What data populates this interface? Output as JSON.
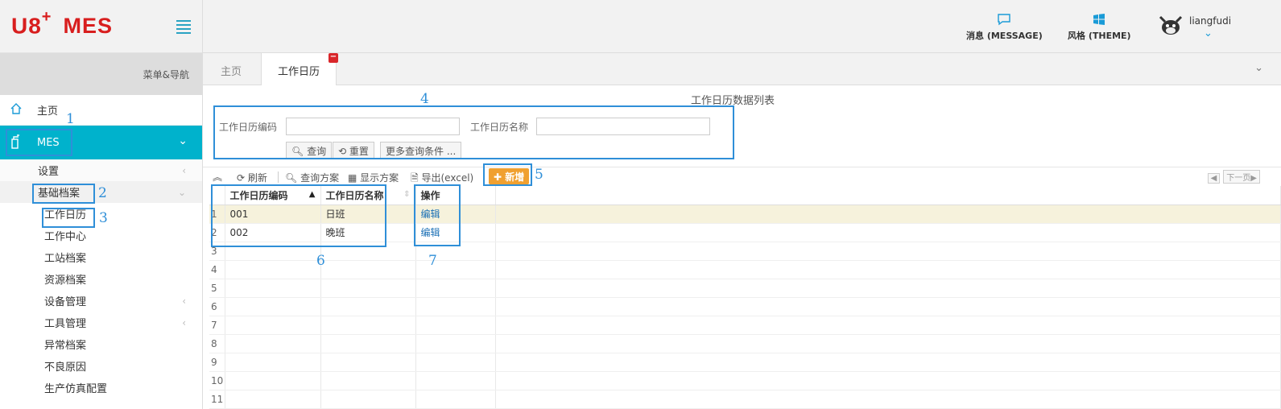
{
  "brand": {
    "logo_main": "U8",
    "logo_plus": "+",
    "logo_mes": "MES"
  },
  "header": {
    "message_label": "消息 (MESSAGE)",
    "theme_label": "风格 (THEME)",
    "username": "liangfudi"
  },
  "sidebar": {
    "caption": "菜单&导航",
    "home": "主页",
    "mes": "MES",
    "items": [
      {
        "label": "设置",
        "chevron": "‹"
      },
      {
        "label": "基础档案",
        "chevron": "⌄"
      }
    ],
    "subitems": [
      {
        "label": "工作日历"
      },
      {
        "label": "工作中心"
      },
      {
        "label": "工站档案"
      },
      {
        "label": "资源档案"
      },
      {
        "label": "设备管理",
        "chevron": "‹"
      },
      {
        "label": "工具管理",
        "chevron": "‹"
      },
      {
        "label": "异常档案"
      },
      {
        "label": "不良原因"
      },
      {
        "label": "生产仿真配置"
      }
    ]
  },
  "tabs": {
    "home": "主页",
    "current": "工作日历",
    "close": "−",
    "more": "⌄"
  },
  "main": {
    "title": "工作日历数据列表",
    "query": {
      "code_label": "工作日历编码",
      "code_value": "",
      "name_label": "工作日历名称",
      "name_value": "",
      "search": "查询",
      "reset": "重置",
      "more": "更多查询条件 ..."
    },
    "toolbar": {
      "refresh": "刷新",
      "query_scheme": "查询方案",
      "display_scheme": "显示方案",
      "export": "导出(excel)",
      "add": "新增",
      "pager_prev": "◀",
      "pager_next": "下一页▶"
    },
    "table": {
      "columns": [
        "工作日历编码",
        "工作日历名称",
        "操作"
      ],
      "rows": [
        {
          "n": "1",
          "code": "001",
          "name": "日班",
          "op": "编辑"
        },
        {
          "n": "2",
          "code": "002",
          "name": "晚班",
          "op": "编辑"
        },
        {
          "n": "3"
        },
        {
          "n": "4"
        },
        {
          "n": "5"
        },
        {
          "n": "6"
        },
        {
          "n": "7"
        },
        {
          "n": "8"
        },
        {
          "n": "9"
        },
        {
          "n": "10"
        },
        {
          "n": "11"
        }
      ]
    }
  },
  "annotations": [
    "1",
    "2",
    "3",
    "4",
    "5",
    "6",
    "7"
  ],
  "colors": {
    "accent": "#00b2cc",
    "logo": "#d81e1e",
    "annotation": "#2f8fd8",
    "add": "#f0a030"
  }
}
